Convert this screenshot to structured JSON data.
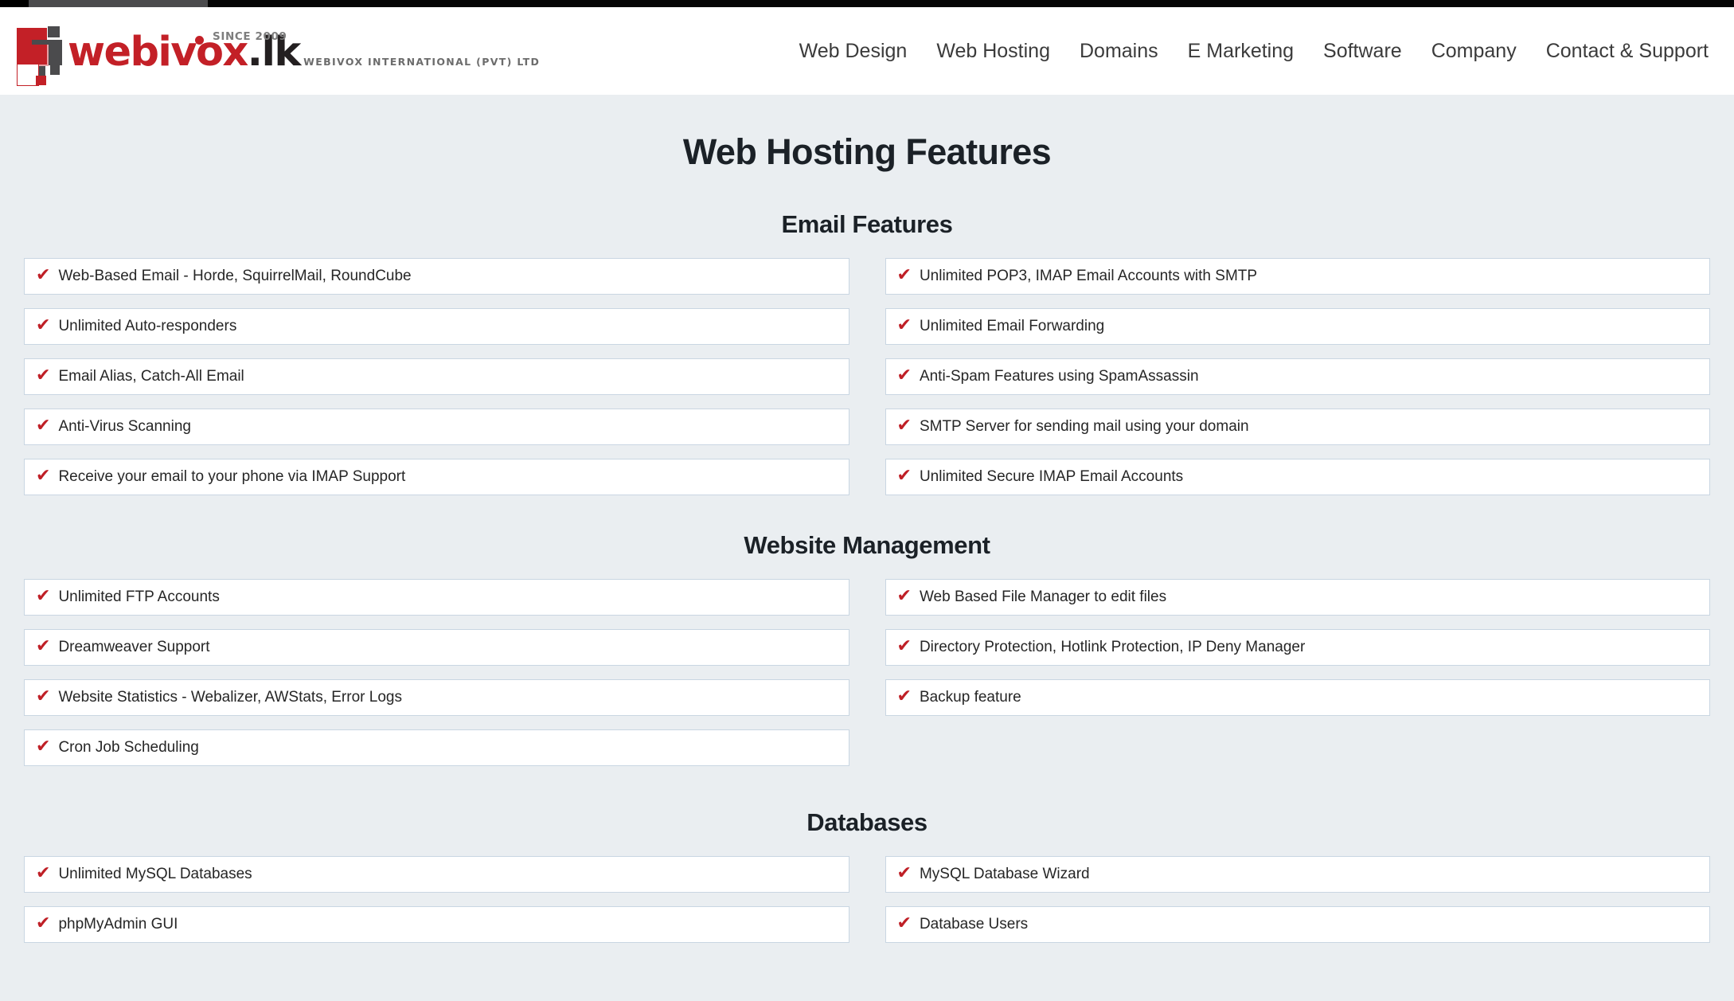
{
  "brand": {
    "since": "SINCE 2009",
    "name_main": "webivox",
    "name_tld": ".lk",
    "tagline": "WEBIVOX INTERNATIONAL (PVT) LTD",
    "red": "#c32027",
    "dark": "#4b4b4d"
  },
  "nav": {
    "items": [
      {
        "label": "Web Design"
      },
      {
        "label": "Web Hosting"
      },
      {
        "label": "Domains"
      },
      {
        "label": "E Marketing"
      },
      {
        "label": "Software"
      },
      {
        "label": "Company"
      },
      {
        "label": "Contact & Support"
      }
    ]
  },
  "page": {
    "title": "Web Hosting Features",
    "check_glyph": "✔",
    "card_border": "#c9d6e2",
    "background": "#eaeef1"
  },
  "sections": [
    {
      "heading": "Email Features",
      "left": [
        "Web-Based Email - Horde, SquirrelMail, RoundCube",
        "Unlimited Auto-responders",
        "Email Alias, Catch-All Email",
        "Anti-Virus Scanning",
        "Receive your email to your phone via IMAP Support"
      ],
      "right": [
        "Unlimited POP3, IMAP Email Accounts with SMTP",
        "Unlimited Email Forwarding",
        "Anti-Spam Features using SpamAssassin",
        "SMTP Server for sending mail using your domain",
        "Unlimited Secure IMAP Email Accounts"
      ]
    },
    {
      "heading": "Website Management",
      "left": [
        "Unlimited FTP Accounts",
        "Dreamweaver Support",
        "Website Statistics - Webalizer, AWStats, Error Logs",
        "Cron Job Scheduling"
      ],
      "right": [
        "Web Based File Manager to edit files",
        "Directory Protection, Hotlink Protection, IP Deny Manager",
        "Backup feature"
      ]
    },
    {
      "heading": "Databases",
      "left": [
        "Unlimited MySQL Databases",
        "phpMyAdmin GUI"
      ],
      "right": [
        "MySQL Database Wizard",
        "Database Users"
      ]
    }
  ]
}
